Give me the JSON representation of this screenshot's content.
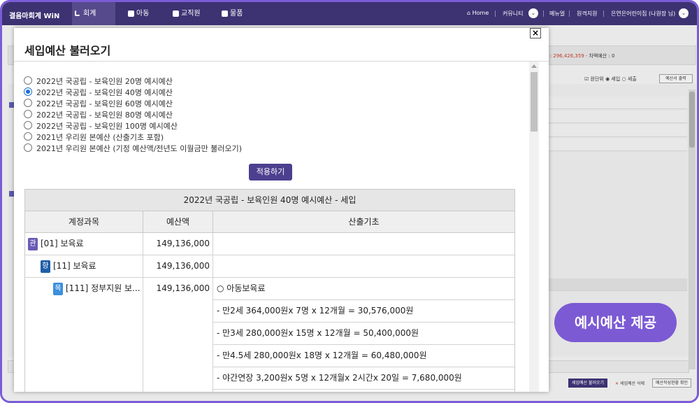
{
  "topnav": {
    "brand": "결음마회계 WiN",
    "tabs": [
      "회계",
      "아동",
      "교직원",
      "물품"
    ],
    "home": "Home",
    "community": "커뮤니티",
    "manual": "메뉴얼",
    "remote": "원격지원",
    "user": "은연은어린이집 (나원장 님)"
  },
  "background": {
    "summary_label": "산 : ",
    "summary_value": "296,426,359",
    "summary_diff": " · 차액예산 : 0",
    "option_won": "원단위",
    "option_income": "세입",
    "option_expense": "세출",
    "print_label": "예산서 출력",
    "btn_load": "세입예산 불러오기",
    "btn_delete": "세입예산 삭제",
    "btn_status": "예산작성현황 확인"
  },
  "modal": {
    "title": "세입예산 불러오기",
    "close": "×",
    "options": [
      "2022년 국공립 - 보육인원 20명 예시예산",
      "2022년 국공립 - 보육인원 40명 예시예산",
      "2022년 국공립 - 보육인원 60명 예시예산",
      "2022년 국공립 - 보육인원 80명 예시예산",
      "2022년 국공립 - 보육인원 100명 예시예산",
      "2021년 우리원 본예산 (산출기초 포함)",
      "2021년 우리원 본예산 (기정 예산액/전년도 이월금만 불러오기)"
    ],
    "selected_index": 1,
    "apply_label": "적용하기",
    "table": {
      "caption": "2022년 국공립 - 보육인원 40명 예시예산 - 세입",
      "headers": [
        "계정과목",
        "예산액",
        "산출기초"
      ],
      "rows": [
        {
          "badge": "관",
          "account": "[01] 보육료",
          "amount": "149,136,000",
          "basis": ""
        },
        {
          "badge": "항",
          "account": "[11] 보육료",
          "amount": "149,136,000",
          "basis": ""
        },
        {
          "badge": "목",
          "account": "[111] 정부지원 보...",
          "amount": "149,136,000",
          "basis": "○ 아동보육료"
        }
      ],
      "basis_lines": [
        "- 만2세 364,000원x 7명 x 12개월 = 30,576,000원",
        "- 만3세 280,000원x 15명 x 12개월 = 50,400,000원",
        "- 만4.5세 280,000원x 18명 x 12개월 = 60,480,000원",
        "- 야간연장 3,200원x 5명 x 12개월x 2시간x 20일 = 7,680,000원"
      ]
    }
  },
  "promo_label": "예시예산 제공",
  "colors": {
    "nav": "#3d3272",
    "accent": "#7c5ad4",
    "button": "#4d3f8f"
  }
}
